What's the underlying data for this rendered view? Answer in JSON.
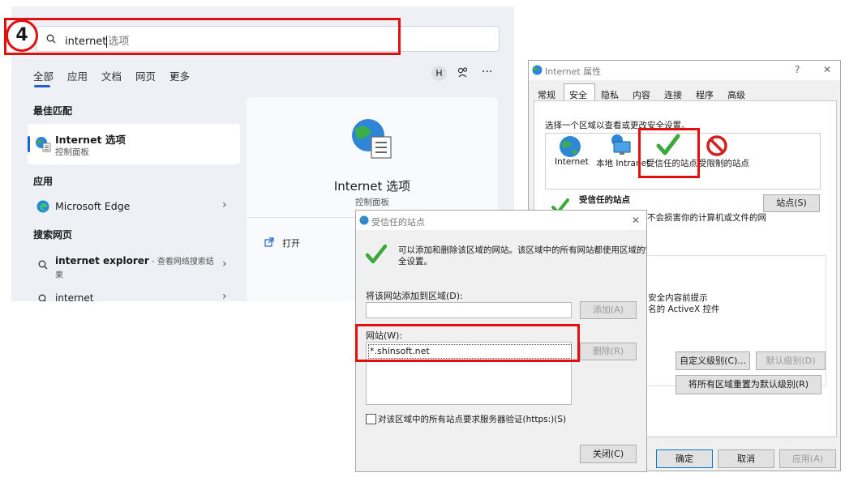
{
  "step_badge": "4",
  "search": {
    "query": "internet",
    "hint": "选项",
    "tabs": [
      "全部",
      "应用",
      "文档",
      "网页",
      "更多"
    ],
    "avatar_letter": "H",
    "sections": {
      "best_match": "最佳匹配",
      "apps": "应用",
      "web": "搜索网页"
    },
    "best_match_item": {
      "title": "Internet 选项",
      "subtitle": "控制面板"
    },
    "app_item": {
      "title": "Microsoft Edge"
    },
    "web_items": [
      {
        "title": "internet explorer",
        "suffix": " - 查看网络搜索结",
        "suffix2": "果"
      },
      {
        "title": "internet"
      }
    ],
    "detail": {
      "title": "Internet 选项",
      "subtitle": "控制面板",
      "action": "打开"
    }
  },
  "props_dialog": {
    "title": "Internet 属性",
    "help": "?",
    "close": "✕",
    "tabs": [
      "常规",
      "安全",
      "隐私",
      "内容",
      "连接",
      "程序",
      "高级"
    ],
    "select_zone_text": "选择一个区域以查看或更改安全设置。",
    "zones": [
      "Internet",
      "本地 Intranet",
      "受信任的站点",
      "受限制的站点"
    ],
    "zone_heading": "受信任的站点",
    "sites_button": "站点(S)",
    "desc_fragment": "不会损害你的计算机或文件的网",
    "level_fragment_1": "- 安全内容前提示",
    "level_fragment_2": "- 名的 ActiveX 控件",
    "custom_level_button": "自定义级别(C)...",
    "default_level_button": "默认级别(D)",
    "reset_all_button": "将所有区域重置为默认级别(R)",
    "ok_button": "确定",
    "cancel_button": "取消",
    "apply_button": "应用(A)"
  },
  "trusted_dialog": {
    "title": "受信任的站点",
    "close": "✕",
    "info_text_1": "可以添加和删除该区域的网站。该区域中的所有网站都使用区域的安",
    "info_text_2": "全设置。",
    "add_label": "将该网站添加到区域(D):",
    "add_value": "",
    "add_button": "添加(A)",
    "sites_label": "网站(W):",
    "sites": [
      "*.shinsoft.net"
    ],
    "remove_button": "删除(R)",
    "https_checkbox": "对该区域中的所有站点要求服务器验证(https:)(S)",
    "close_button": "关闭(C)"
  },
  "colors": {
    "highlight_red": "#e01010",
    "accent_blue": "#2064c9",
    "check_green": "#3aa93a"
  }
}
